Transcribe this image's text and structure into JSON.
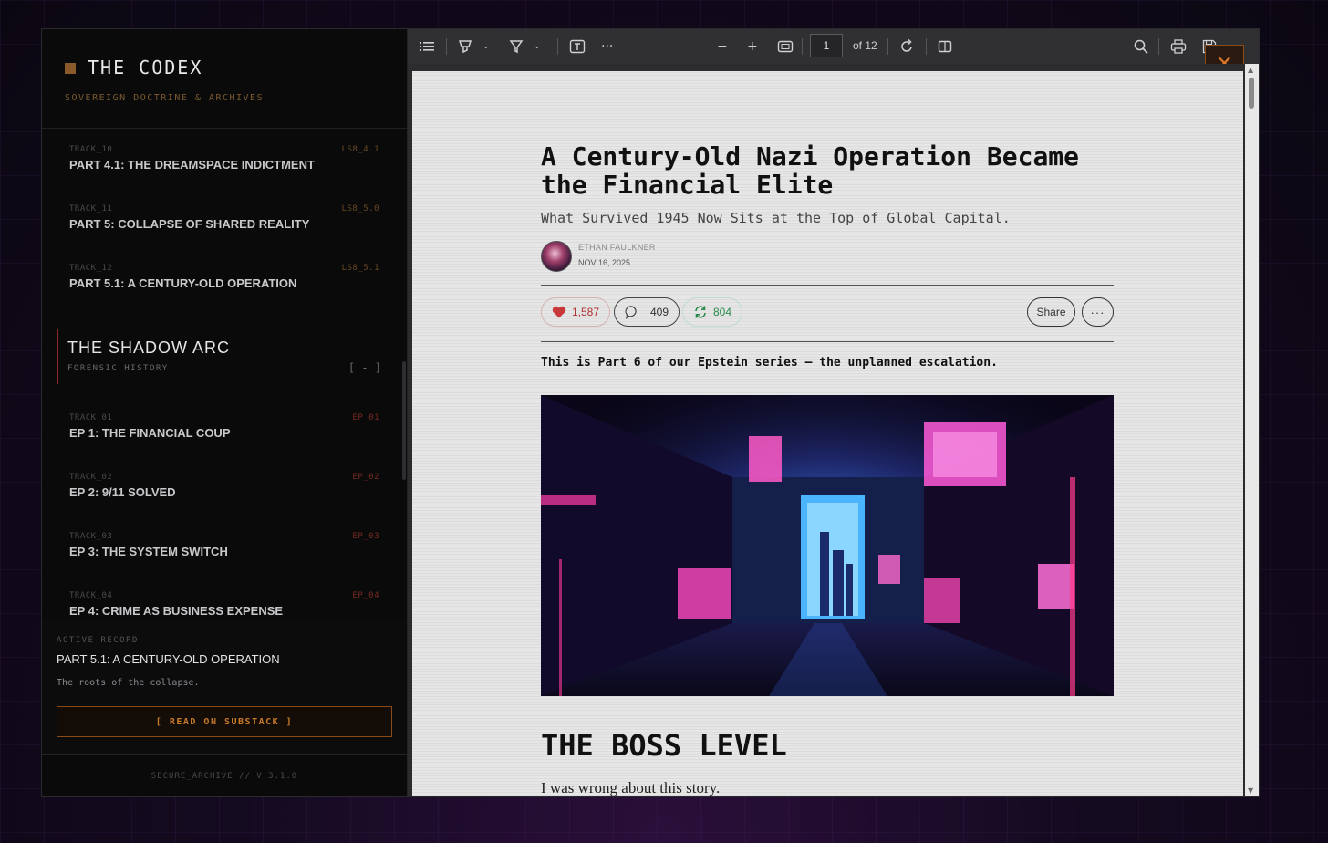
{
  "sidebar": {
    "brand_title": "THE CODEX",
    "brand_subtitle": "SOVEREIGN DOCTRINE & ARCHIVES",
    "top_tracks": [
      {
        "id": "TRACK_10",
        "code": "LS8_4.1",
        "title": "PART 4.1: THE DREAMSPACE INDICTMENT"
      },
      {
        "id": "TRACK_11",
        "code": "LS8_5.0",
        "title": "PART 5: COLLAPSE OF SHARED REALITY"
      },
      {
        "id": "TRACK_12",
        "code": "LS8_5.1",
        "title": "PART 5.1: A CENTURY-OLD OPERATION"
      }
    ],
    "arc": {
      "title": "THE SHADOW ARC",
      "subtitle": "FORENSIC HISTORY",
      "toggle": "[ - ]"
    },
    "arc_tracks": [
      {
        "id": "TRACK_01",
        "code": "EP_01",
        "title": "EP 1: THE FINANCIAL COUP"
      },
      {
        "id": "TRACK_02",
        "code": "EP_02",
        "title": "EP 2: 9/11 SOLVED"
      },
      {
        "id": "TRACK_03",
        "code": "EP_03",
        "title": "EP 3: THE SYSTEM SWITCH"
      },
      {
        "id": "TRACK_04",
        "code": "EP_04",
        "title": "EP 4: CRIME AS BUSINESS EXPENSE"
      }
    ],
    "active": {
      "label": "ACTIVE RECORD",
      "title": "PART 5.1: A CENTURY-OLD OPERATION",
      "description": "The roots of the collapse.",
      "button": "[ READ ON SUBSTACK ]"
    },
    "footer": "SECURE_ARCHIVE // V.3.1.0"
  },
  "toolbar": {
    "page_current": "1",
    "page_total": "of 12",
    "close_label": "✕"
  },
  "article": {
    "title": "A Century-Old Nazi Operation Became the Financial Elite",
    "subtitle": "What Survived 1945 Now Sits at the Top of Global Capital.",
    "author": "ETHAN FAULKNER",
    "date": "NOV 16, 2025",
    "likes": "1,587",
    "comments": "409",
    "restacks": "804",
    "share": "Share",
    "more": "···",
    "intro": "This is Part 6 of our Epstein series — the unplanned escalation.",
    "section_title": "THE BOSS LEVEL",
    "body_first_line": "I was wrong about this story."
  },
  "colors": {
    "accent_amber": "#c87a2a",
    "accent_red": "#8a2a22",
    "like_red": "#b03030",
    "restack_green": "#2a8a4a"
  }
}
